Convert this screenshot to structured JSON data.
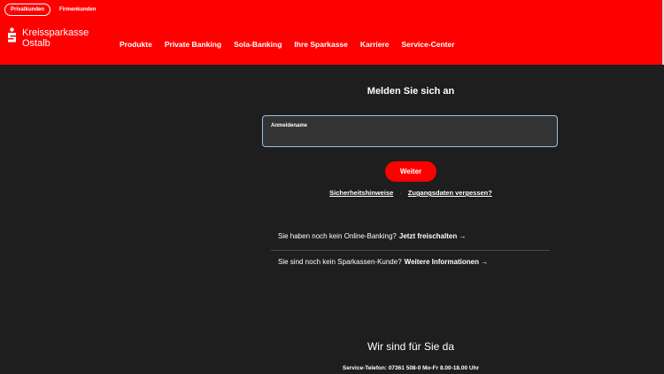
{
  "header": {
    "segments": {
      "active": "Privatkunden",
      "inactive": "Firmenkunden"
    },
    "brand": {
      "line1": "Kreissparkasse",
      "line2": "Ostalb"
    },
    "nav": [
      "Produkte",
      "Private Banking",
      "Sola-Banking",
      "Ihre Sparkasse",
      "Karriere",
      "Service-Center"
    ]
  },
  "login": {
    "title": "Melden Sie sich an",
    "username_label": "Anmeldename",
    "submit_label": "Weiter",
    "link_security": "Sicherheitshinweise",
    "link_separator": "·",
    "link_forgot": "Zugangsdaten vergessen?"
  },
  "info": {
    "line1_text": "Sie haben noch kein Online-Banking?",
    "line1_link": "Jetzt freischalten →",
    "line2_text": "Sie sind noch kein Sparkassen-Kunde?",
    "line2_link": "Weitere Informationen →"
  },
  "footer": {
    "title": "Wir sind für Sie da",
    "service": "Service-Telefon: 07361 508-0 Mo-Fr 8.00-18.00 Uhr"
  },
  "colors": {
    "brand_red": "#ff0000",
    "background": "#1e1e1e"
  }
}
